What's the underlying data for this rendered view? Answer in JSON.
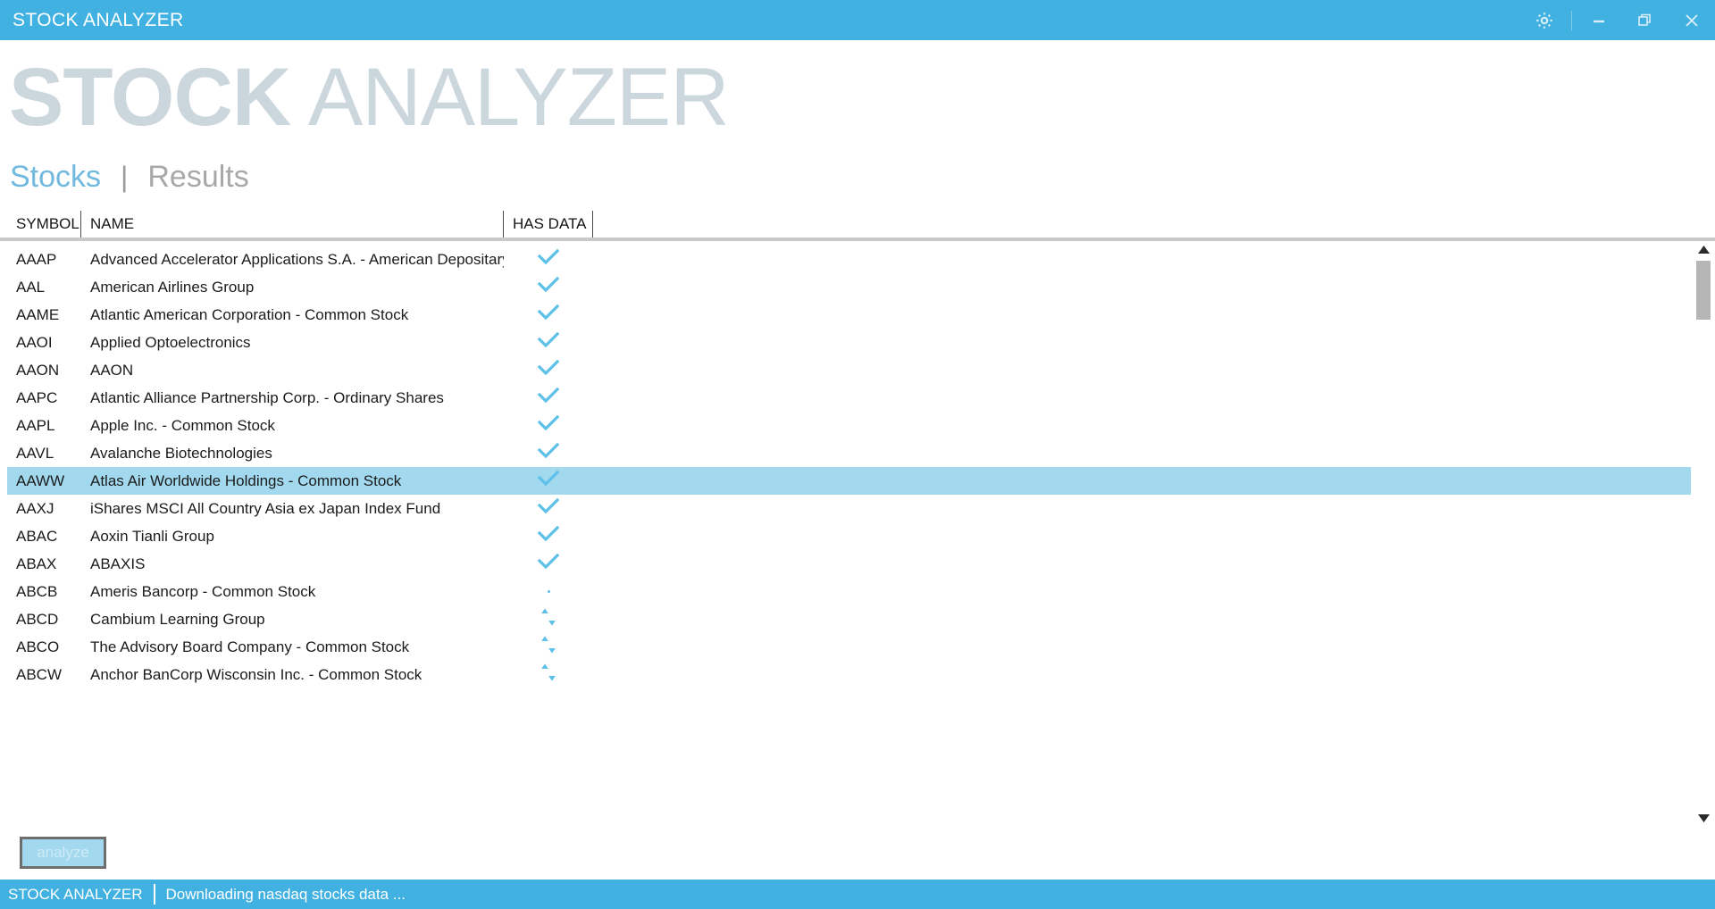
{
  "titlebar": {
    "title": "STOCK ANALYZER",
    "settings_icon": "gear-icon",
    "minimize_icon": "minimize-icon",
    "restore_icon": "restore-icon",
    "close_icon": "close-icon"
  },
  "header": {
    "title_bold": "STOCK",
    "title_light": " ANALYZER"
  },
  "tabs": {
    "separator": "|",
    "items": [
      {
        "label": "Stocks",
        "active": true
      },
      {
        "label": "Results",
        "active": false
      }
    ]
  },
  "table": {
    "columns": [
      "SYMBOL",
      "NAME",
      "HAS DATA"
    ],
    "rows": [
      {
        "symbol": "AAAP",
        "name": "Advanced Accelerator Applications S.A. - American Depositary Shares",
        "has_data": "check",
        "selected": false
      },
      {
        "symbol": "AAL",
        "name": "American Airlines Group",
        "has_data": "check",
        "selected": false
      },
      {
        "symbol": "AAME",
        "name": "Atlantic American Corporation - Common Stock",
        "has_data": "check",
        "selected": false
      },
      {
        "symbol": "AAOI",
        "name": "Applied Optoelectronics",
        "has_data": "check",
        "selected": false
      },
      {
        "symbol": "AAON",
        "name": "AAON",
        "has_data": "check",
        "selected": false
      },
      {
        "symbol": "AAPC",
        "name": "Atlantic Alliance Partnership Corp. - Ordinary Shares",
        "has_data": "check",
        "selected": false
      },
      {
        "symbol": "AAPL",
        "name": "Apple Inc. - Common Stock",
        "has_data": "check",
        "selected": false
      },
      {
        "symbol": "AAVL",
        "name": "Avalanche Biotechnologies",
        "has_data": "check",
        "selected": false
      },
      {
        "symbol": "AAWW",
        "name": "Atlas Air Worldwide Holdings - Common Stock",
        "has_data": "check",
        "selected": true
      },
      {
        "symbol": "AAXJ",
        "name": "iShares MSCI All Country Asia ex Japan Index Fund",
        "has_data": "check",
        "selected": false
      },
      {
        "symbol": "ABAC",
        "name": "Aoxin Tianli Group",
        "has_data": "check",
        "selected": false
      },
      {
        "symbol": "ABAX",
        "name": "ABAXIS",
        "has_data": "check",
        "selected": false
      },
      {
        "symbol": "ABCB",
        "name": "Ameris Bancorp - Common Stock",
        "has_data": "dot",
        "selected": false
      },
      {
        "symbol": "ABCD",
        "name": "Cambium Learning Group",
        "has_data": "sync",
        "selected": false
      },
      {
        "symbol": "ABCO",
        "name": "The Advisory Board Company - Common Stock",
        "has_data": "sync",
        "selected": false
      },
      {
        "symbol": "ABCW",
        "name": "Anchor BanCorp Wisconsin Inc. - Common Stock",
        "has_data": "sync",
        "selected": false
      }
    ]
  },
  "scrollbar": {
    "up_icon": "scroll-up-arrow-icon",
    "down_icon": "scroll-down-arrow-icon"
  },
  "footer": {
    "analyze_label": "analyze"
  },
  "statusbar": {
    "app_name": "STOCK ANALYZER",
    "message": "Downloading nasdaq stocks data ..."
  },
  "colors": {
    "accent": "#41b1e1",
    "accent_light": "#5cc0e8",
    "selection": "#a2d9ef",
    "header_text": "#ccd6dd",
    "tab_active": "#72b9e0",
    "tab_inactive": "#a8a8a8"
  }
}
